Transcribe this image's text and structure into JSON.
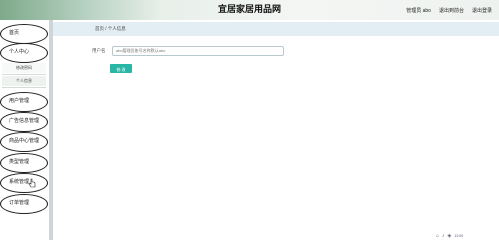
{
  "header": {
    "title": "宜居家居用品网",
    "admin_label": "管理员 abo",
    "back_to_front": "退出到前台",
    "logout": "退出登录"
  },
  "sidebar": {
    "items": [
      {
        "label": "首页"
      },
      {
        "label": "个人中心"
      },
      {
        "label": "用户管理"
      },
      {
        "label": "广告信息管理"
      },
      {
        "label": "商品中心管理"
      },
      {
        "label": "类型管理"
      },
      {
        "label": "系统管理"
      },
      {
        "label": "订单管理"
      }
    ],
    "sub_items": [
      {
        "label": "修改密码"
      },
      {
        "label": "个人信息"
      }
    ]
  },
  "breadcrumb": {
    "home": "首页",
    "separator": "/",
    "current": "个人信息"
  },
  "form": {
    "username_label": "用户名",
    "username_value": "abo管理员账号名称默认abo",
    "submit_label": "修 改"
  },
  "tray": {
    "icons": [
      "network-icon",
      "volume-icon",
      "language-icon"
    ],
    "time": "12:00"
  },
  "colors": {
    "accent": "#29b6a5",
    "breadcrumb_bg": "#e3edf4",
    "header_gradient_start": "#7ea98a"
  }
}
